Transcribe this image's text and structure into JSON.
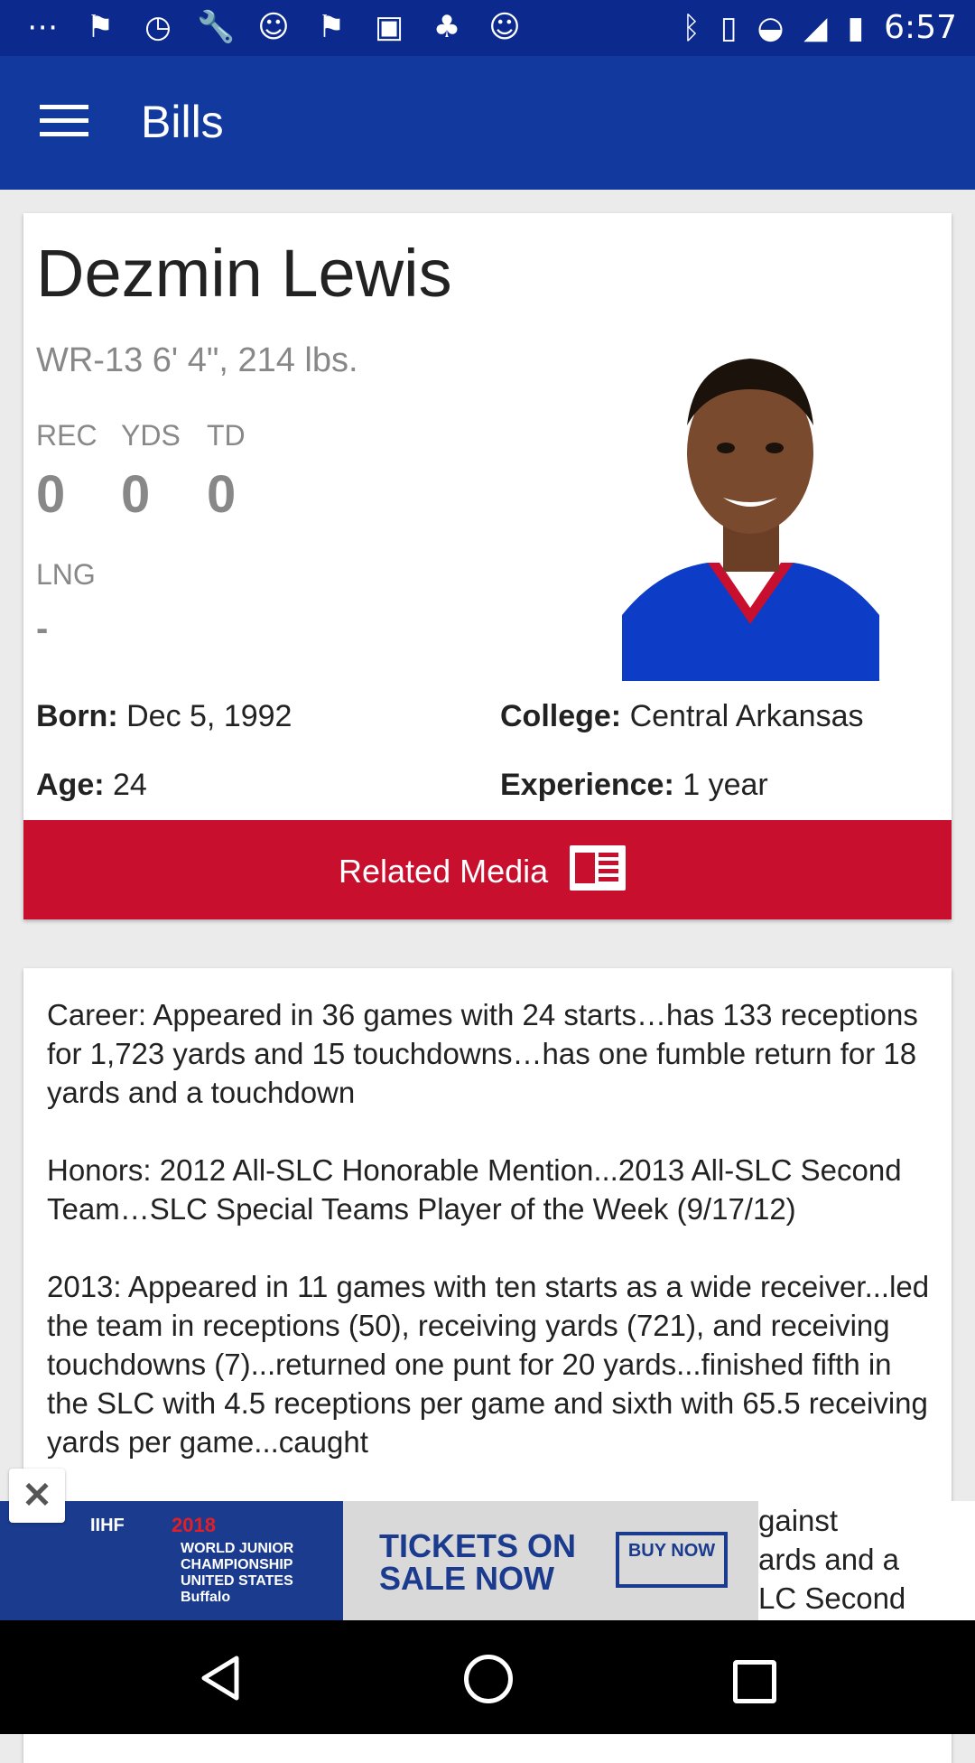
{
  "status_bar": {
    "time": "6:57",
    "icons": [
      "messages-icon",
      "flag-icon",
      "timer-icon",
      "wrench-icon",
      "smiley-icon",
      "flag-icon",
      "qt-icon",
      "game-icon",
      "smiley-icon",
      "bluetooth-icon",
      "vibrate-icon",
      "wifi-icon",
      "signal-icon",
      "battery-icon"
    ]
  },
  "app_bar": {
    "title": "Bills"
  },
  "player": {
    "name": "Dezmin Lewis",
    "position_line": "WR-13 6' 4\", 214 lbs.",
    "stats": [
      {
        "label": "REC",
        "value": "0"
      },
      {
        "label": "YDS",
        "value": "0"
      },
      {
        "label": "TD",
        "value": "0"
      }
    ],
    "lng": {
      "label": "LNG",
      "value": "-"
    },
    "born_label": "Born:",
    "born_value": "Dec 5, 1992",
    "college_label": "College:",
    "college_value": "Central Arkansas",
    "age_label": "Age:",
    "age_value": "24",
    "experience_label": "Experience:",
    "experience_value": "1 year",
    "related_media_label": "Related Media"
  },
  "bio": {
    "text": "Career: Appeared in 36 games with 24 starts…has 133 receptions for 1,723 yards and 15 touchdowns…has one fumble return for 18 yards and a touchdown\n\nHonors: 2012 All-SLC Honorable Mention...2013 All-SLC Second Team…SLC Special Teams Player of the Week (9/17/12)\n\n2013: Appeared in 11 games with ten starts as a wide receiver...led the team in receptions (50), receiving yards (721), and receiving touchdowns (7)...returned one punt for 20 yards...finished fifth in the SLC with 4.5 receptions per game and sixth with 65.5 receiving yards per game...caught"
  },
  "ad": {
    "org": "IIHF",
    "year": "2018",
    "event": "WORLD JUNIOR CHAMPIONSHIP UNITED STATES Buffalo",
    "headline": "TICKETS ON SALE NOW",
    "cta": "BUY NOW",
    "bio_tail": [
      "gainst",
      "ards and a",
      "LC Second"
    ]
  },
  "colors": {
    "status_bar": "#0c2a8e",
    "app_bar": "#123a9e",
    "related_media": "#c8102e",
    "jersey": "#0d3cc7"
  }
}
